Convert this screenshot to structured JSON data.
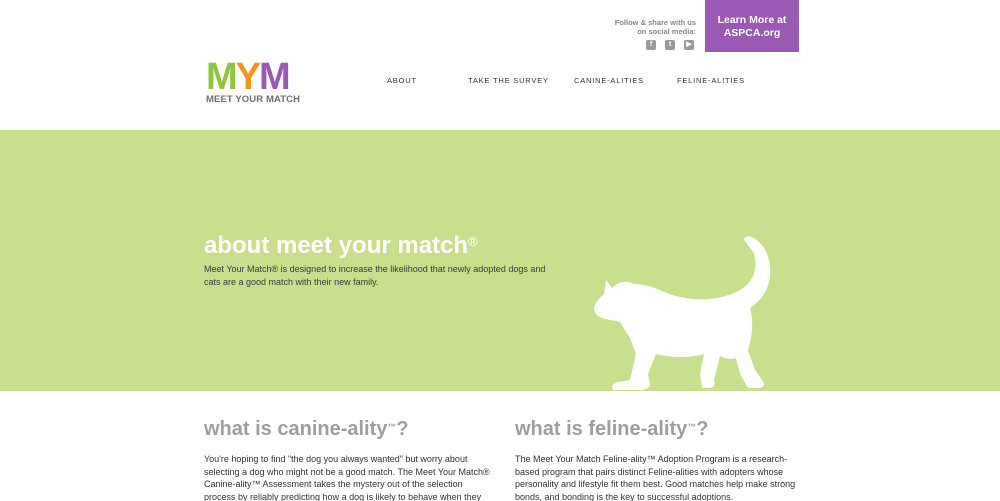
{
  "header": {
    "logo": {
      "letters": [
        "M",
        "Y",
        "M"
      ],
      "tagline": "MEET YOUR MATCH"
    },
    "social": {
      "text": "Follow & share with us on social media:",
      "icons": [
        "facebook-icon",
        "twitter-icon",
        "youtube-icon"
      ]
    },
    "cta": {
      "line1": "Learn More at",
      "line2": "ASPCA.org"
    },
    "nav": [
      "ABOUT",
      "TAKE THE SURVEY",
      "CANINE-ALITIES",
      "FELINE-ALITIES"
    ]
  },
  "hero": {
    "title": "about meet your match",
    "title_mark": "®",
    "text": "Meet Your Match® is designed to increase the likelihood that newly adopted dogs and cats are a good match with their new family."
  },
  "sections": [
    {
      "title": "what is canine-ality",
      "mark": "™",
      "suffix": "?",
      "text": "You're hoping to find \"the dog you always wanted\" but worry about selecting a dog who might not be a good match. The Meet Your Match® Canine-ality™ Assessment takes the mystery out of the selection process by reliably predicting how a dog is likely to behave when they arrive in your"
    },
    {
      "title": "what is feline-ality",
      "mark": "™",
      "suffix": "?",
      "text": "The Meet Your Match Feline-ality™ Adoption Program is a research-based program that pairs distinct Feline-alities with adopters whose personality and lifestyle fit them best. Good matches help make strong bonds, and bonding is the key to successful adoptions."
    }
  ],
  "colors": {
    "green": "#c8df8e",
    "purple": "#9b59b6",
    "logo_green": "#8dc63f",
    "logo_orange": "#f7941d",
    "heading_gray": "#9e9e9e"
  }
}
